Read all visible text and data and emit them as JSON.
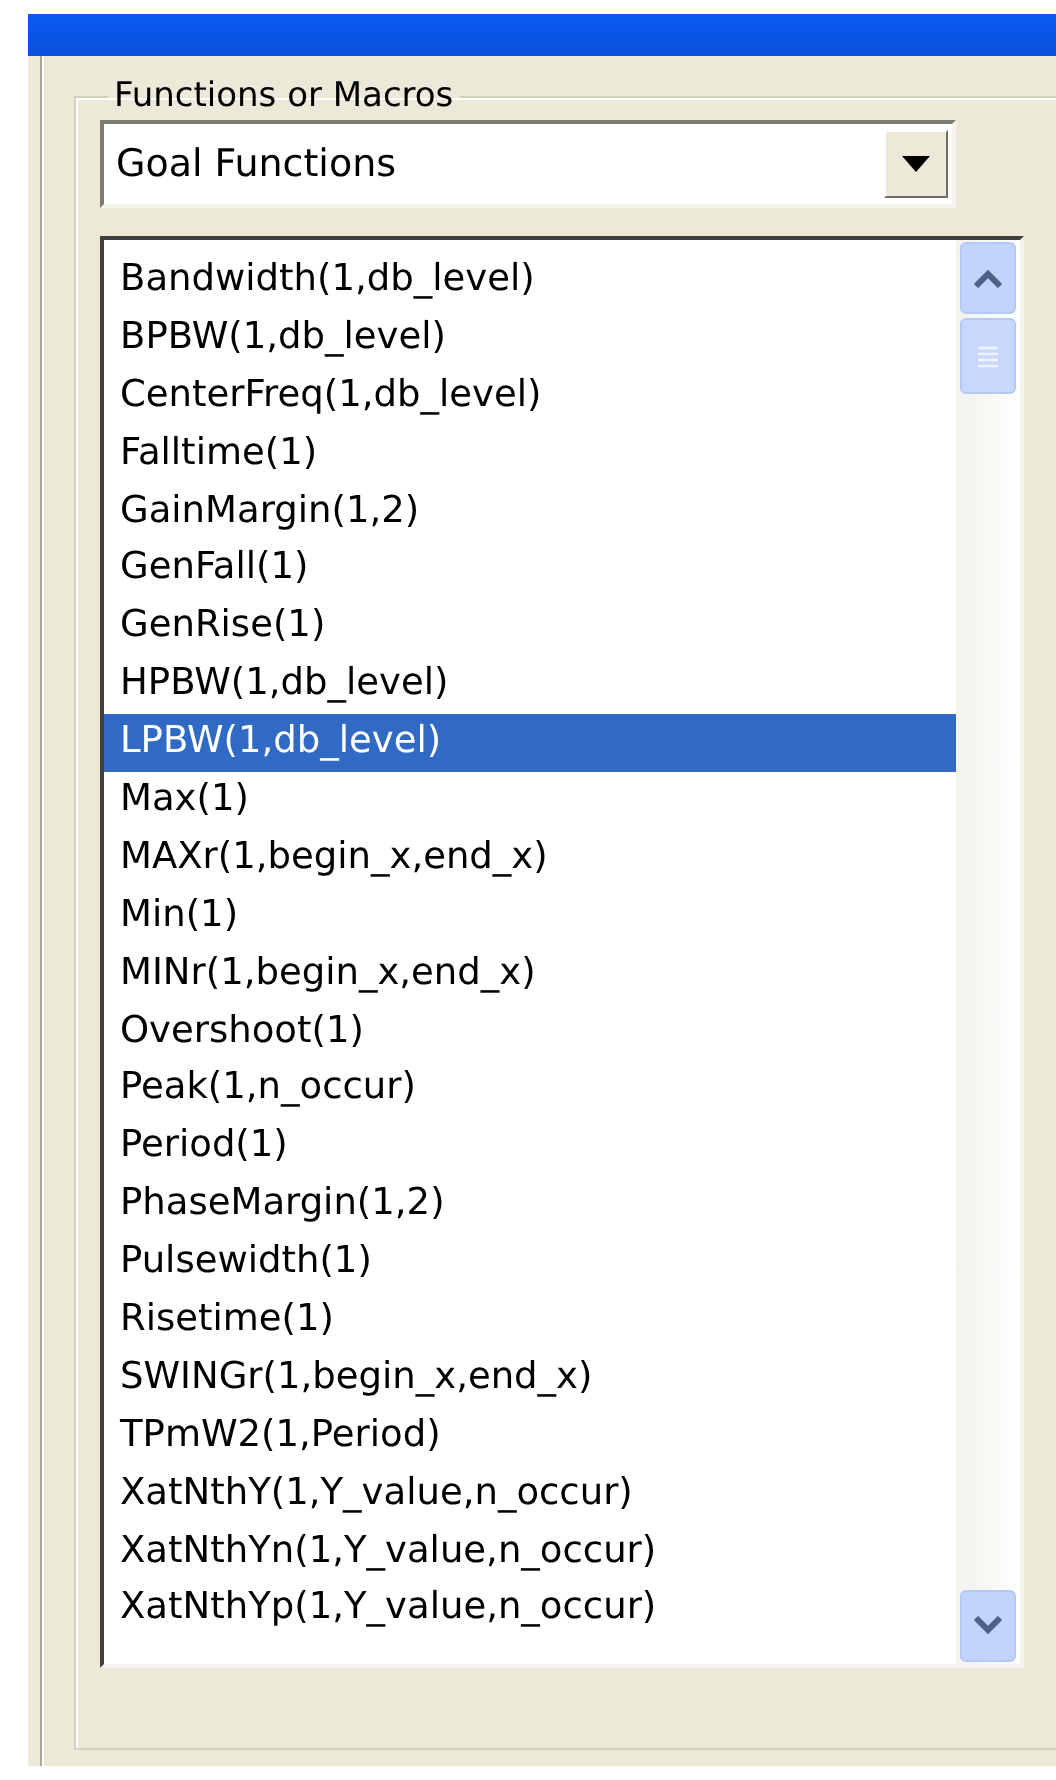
{
  "group": {
    "title": "Functions or Macros"
  },
  "dropdown": {
    "value": "Goal Functions"
  },
  "list": {
    "items": [
      {
        "label": "Bandwidth(1,db_level)",
        "selected": false
      },
      {
        "label": "BPBW(1,db_level)",
        "selected": false
      },
      {
        "label": "CenterFreq(1,db_level)",
        "selected": false
      },
      {
        "label": "Falltime(1)",
        "selected": false
      },
      {
        "label": "GainMargin(1,2)",
        "selected": false
      },
      {
        "label": "GenFall(1)",
        "selected": false
      },
      {
        "label": "GenRise(1)",
        "selected": false
      },
      {
        "label": "HPBW(1,db_level)",
        "selected": false
      },
      {
        "label": "LPBW(1,db_level)",
        "selected": true
      },
      {
        "label": "Max(1)",
        "selected": false
      },
      {
        "label": "MAXr(1,begin_x,end_x)",
        "selected": false
      },
      {
        "label": "Min(1)",
        "selected": false
      },
      {
        "label": "MINr(1,begin_x,end_x)",
        "selected": false
      },
      {
        "label": "Overshoot(1)",
        "selected": false
      },
      {
        "label": "Peak(1,n_occur)",
        "selected": false
      },
      {
        "label": "Period(1)",
        "selected": false
      },
      {
        "label": "PhaseMargin(1,2)",
        "selected": false
      },
      {
        "label": "Pulsewidth(1)",
        "selected": false
      },
      {
        "label": "Risetime(1)",
        "selected": false
      },
      {
        "label": "SWINGr(1,begin_x,end_x)",
        "selected": false
      },
      {
        "label": "TPmW2(1,Period)",
        "selected": false
      },
      {
        "label": "XatNthY(1,Y_value,n_occur)",
        "selected": false
      },
      {
        "label": "XatNthYn(1,Y_value,n_occur)",
        "selected": false
      },
      {
        "label": "XatNthYp(1,Y_value,n_occur)",
        "selected": false
      }
    ]
  }
}
